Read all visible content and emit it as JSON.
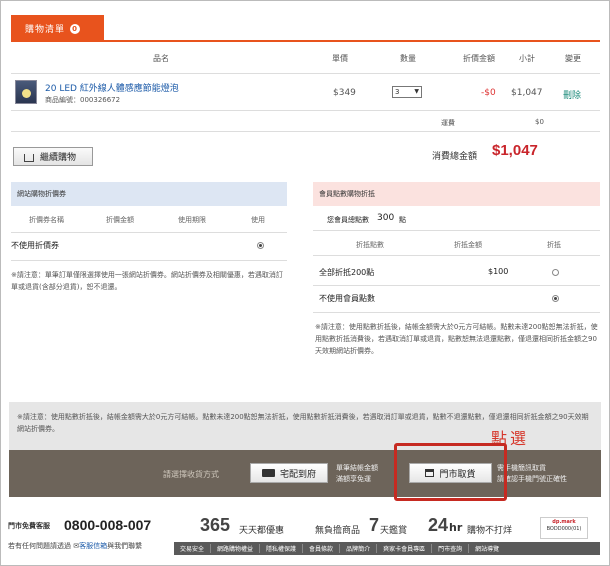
{
  "tab": {
    "label": "購物清單",
    "badge": "0"
  },
  "cart_header": {
    "name": "品名",
    "price": "單價",
    "qty": "數量",
    "discount": "折價金額",
    "subtotal": "小計",
    "change": "變更"
  },
  "item": {
    "name": "20 LED 紅外線人體感應節能燈泡",
    "code": "商品編號：000326672",
    "price": "$349",
    "qty": "3",
    "discount": "-$0",
    "subtotal": "$1,047",
    "delete": "刪除"
  },
  "shipping": {
    "label": "運費",
    "value": "$0"
  },
  "continue_btn": "繼續購物",
  "total": {
    "label": "消費總金額",
    "value": "$1,047"
  },
  "coupon_panel": {
    "title": "網站購物折價券",
    "cols": [
      "折價券名稱",
      "折價金額",
      "使用期限",
      "使用"
    ],
    "row_none": "不使用折價券",
    "note": "※請注意：單筆訂單僅限選擇使用一張網站折價券。網站折價券及相關優惠，若遇取消訂單或退貨(含部分退貨)，恕不退還。"
  },
  "points_panel": {
    "title": "會員點數購物折抵",
    "total_points_label": "您會員總點數",
    "total_points": "300",
    "points_unit": "點",
    "cols": [
      "折抵點數",
      "折抵金額",
      "折抵"
    ],
    "row_all": "全部折抵200點",
    "row_all_amount": "$100",
    "row_none": "不使用會員點數",
    "note": "※請注意：使用點數折抵後，結帳金額需大於0元方可結帳。點數未達200點恕無法折抵，使用點數折抵消費後，若遇取消訂單或退貨，點數恕無法退還點數，僅退還相同折抵金額之90天效期網站折價券。"
  },
  "notice": "※請注意：使用點數折抵後，結帳金額需大於0元方可結帳。點數未達200點恕無法折抵，使用點數折抵消費後，若遇取消訂單或退貨，點數不退還點數，僅退還相同折抵金額之90天效期網站折價券。",
  "pick_annotation": "點選",
  "delivery": {
    "prompt": "請選擇收貨方式",
    "home_btn": "宅配到府",
    "home_note_1": "單筆結帳金額",
    "home_note_2": "滿額享免運",
    "store_btn": "門市取貨",
    "store_note_1": "需手機簡訊取貨",
    "store_note_2": "請確認手機門號正確性"
  },
  "footer": {
    "hotline_label": "門市免費客服",
    "hotline": "0800-008-007",
    "ask": "若有任何問題請透過",
    "mail_link": "客服信箱",
    "ask_tail": "與我們聯繫",
    "promo1_num": "365",
    "promo1_txt": "天天都優惠",
    "promo2_pre": "無負擔商品",
    "promo2_num": "7",
    "promo2_txt": "天鑑賞",
    "promo3_num": "24",
    "promo3_hr": "hr",
    "promo3_txt": "購物不打烊",
    "logo_line1": "dp.mark",
    "logo_line2": "BODD000(01)",
    "links": [
      "交易安全",
      "網路購物權益",
      "隱私權保護",
      "會員條款",
      "品牌簡介",
      "爽家卡會員專區",
      "門市查詢",
      "網站導覽"
    ]
  }
}
